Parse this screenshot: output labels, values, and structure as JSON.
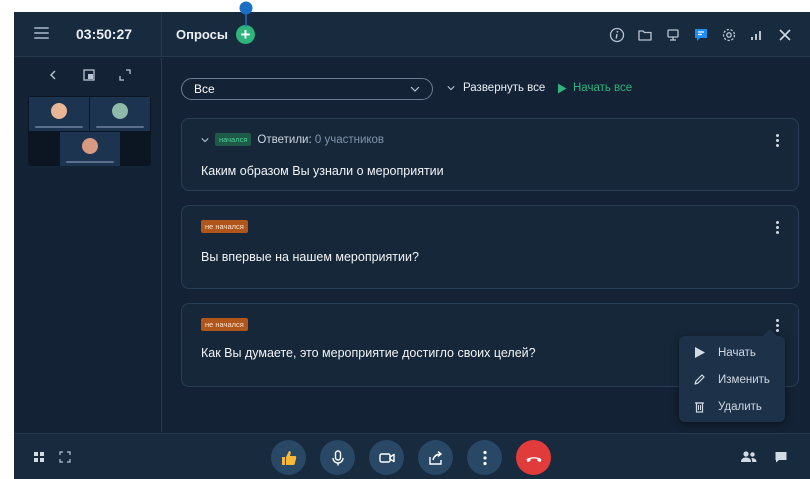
{
  "header": {
    "timer": "03:50:27",
    "title": "Опросы",
    "add_label": "+"
  },
  "toolbar": {
    "filter_value": "Все",
    "expand_all": "Развернуть все",
    "start_all": "Начать все"
  },
  "polls": [
    {
      "status": "начался",
      "answered_label": "Ответили:",
      "answered_value": "0 участников",
      "question": "Каким образом Вы узнали о мероприятии"
    },
    {
      "status": "не начался",
      "question": "Вы впервые на нашем мероприятии?"
    },
    {
      "status": "не начался",
      "question": "Как Вы думаете, это мероприятие достигло своих целей?"
    }
  ],
  "context_menu": {
    "items": [
      "Начать",
      "Изменить",
      "Удалить"
    ]
  },
  "colors": {
    "background": "#132235",
    "accent_green": "#2fb47c",
    "accent_blue": "#1f8ef1",
    "end_call_red": "#e23b3b",
    "not_started_badge": "#b1561b"
  },
  "icons": {
    "top": [
      "info-icon",
      "folder-icon",
      "screen-share-icon",
      "polls-icon",
      "settings-icon",
      "signal-icon",
      "close-icon"
    ],
    "bottom": [
      "thumbs-up-icon",
      "microphone-icon",
      "camera-icon",
      "share-icon",
      "more-icon",
      "end-call-icon"
    ]
  }
}
